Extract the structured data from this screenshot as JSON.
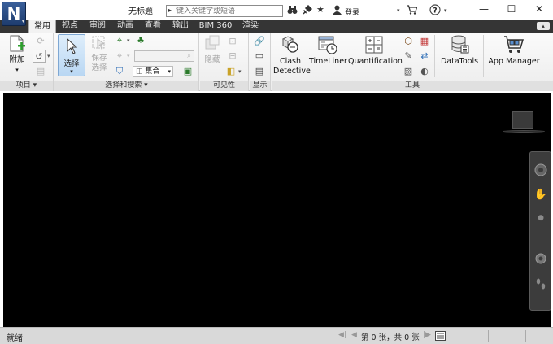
{
  "app": {
    "title": "无标题",
    "logo": "N",
    "logo_caret": "▾"
  },
  "titlebar": {
    "search_placeholder": "键入关键字或短语",
    "search_arrow": "▸",
    "icons": [
      "binoculars-icon",
      "satellite-icon",
      "star-icon",
      "user-icon",
      "cart-icon",
      "help-icon"
    ],
    "login_label": "登录",
    "caret": "▾",
    "minimize": "—",
    "maximize": "☐",
    "close": "✕"
  },
  "tabs": [
    {
      "label": "常用",
      "active": true
    },
    {
      "label": "视点",
      "active": false
    },
    {
      "label": "审阅",
      "active": false
    },
    {
      "label": "动画",
      "active": false
    },
    {
      "label": "查看",
      "active": false
    },
    {
      "label": "输出",
      "active": false
    },
    {
      "label": "BIM 360",
      "active": false
    },
    {
      "label": "渲染",
      "active": false
    }
  ],
  "tabbar_toggle": "▴",
  "ribbon": {
    "project": {
      "append_label": "附加",
      "panel_title": "项目 ▾"
    },
    "select": {
      "select_label": "选择",
      "save_selection_label_1": "保存",
      "save_selection_label_2": "选择",
      "set_combo": "集合",
      "panel_title": "选择和搜索 ▾"
    },
    "visibility": {
      "hide_label": "隐藏",
      "panel_title": "可见性"
    },
    "display": {
      "panel_title": "显示"
    },
    "tools": {
      "clash_label_1": "Clash",
      "clash_label_2": "Detective",
      "timeliner_label": "TimeLiner",
      "quantification_label": "Quantification",
      "datatools_label": "DataTools",
      "appmanager_label": "App Manager",
      "panel_title": "工具"
    }
  },
  "statusbar": {
    "status": "就绪",
    "sheet_info": "第 0 张，共 0 张",
    "nav_first": "◀|",
    "nav_prev": "◀",
    "nav_next": "▶",
    "nav_last": "|▶"
  },
  "colors": {
    "tabbar_bg": "#353535",
    "viewport_bg": "#000000",
    "select_highlight": "#b9d7f3",
    "statusbar_bg": "#d9d9d9"
  }
}
